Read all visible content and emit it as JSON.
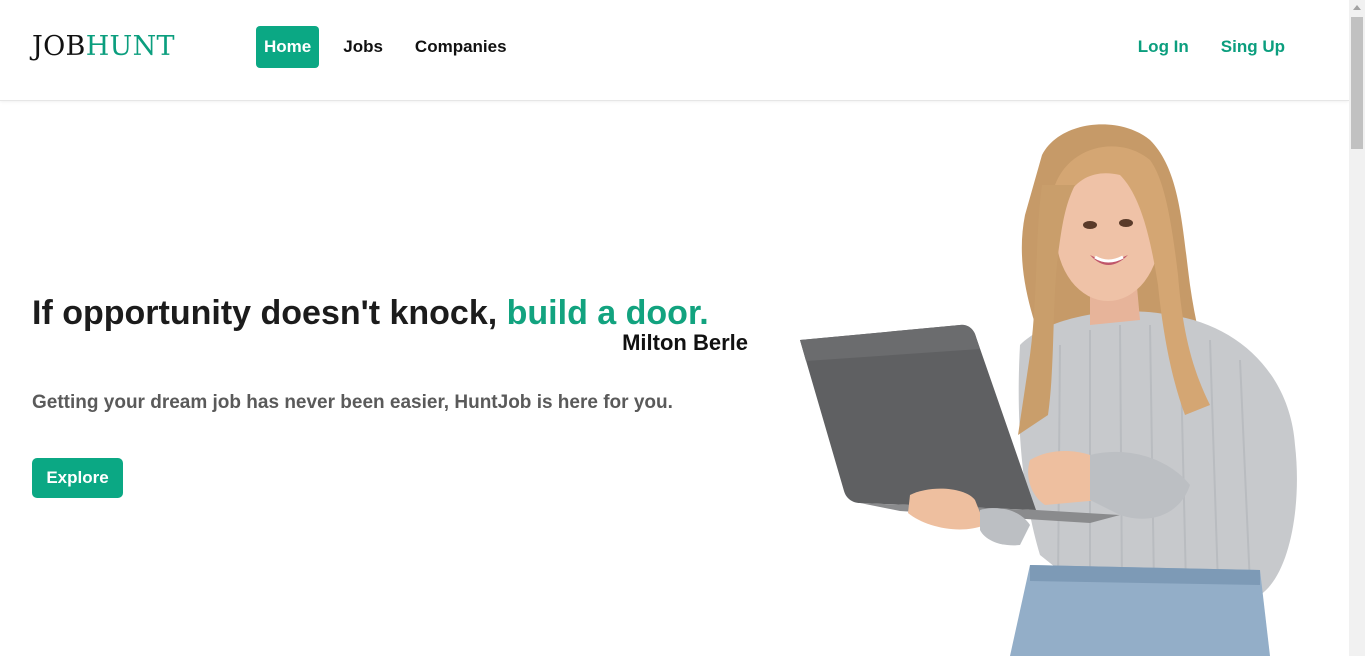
{
  "brand": {
    "part1": "JOB",
    "part2": "HUNT"
  },
  "nav": {
    "items": [
      {
        "label": "Home",
        "active": true
      },
      {
        "label": "Jobs",
        "active": false
      },
      {
        "label": "Companies",
        "active": false
      }
    ]
  },
  "auth": {
    "login": "Log In",
    "signup": "Sing Up"
  },
  "hero": {
    "quote_main": "If opportunity doesn't knock, ",
    "quote_accent": "build a door.",
    "author": "Milton Berle",
    "tagline": "Getting your dream job has never been easier, HuntJob is here for you.",
    "cta": "Explore"
  },
  "colors": {
    "accent": "#0ba884",
    "accent_text": "#0b9e7e",
    "heading": "#1c1c1c",
    "muted": "#5a5a5a"
  },
  "icons": {
    "illustration": "woman-with-laptop-illustration"
  }
}
